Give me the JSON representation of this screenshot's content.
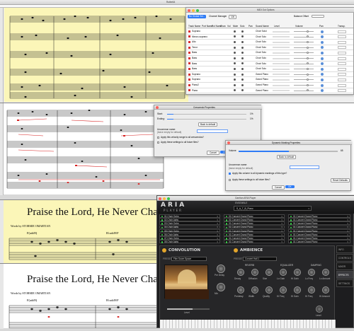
{
  "top_window": {
    "title": "Rutter64"
  },
  "mixer": {
    "title": "MIDI Out Options",
    "header_buttons": [
      "No Global Vol...",
      "Channel Manager",
      "Balance Offset"
    ],
    "header_value": "100",
    "columns": [
      "Track Name",
      "Port Name",
      "Rol Name",
      "Chan",
      "Vol",
      "Mute",
      "Solo",
      "Pan",
      "Sound Name",
      "Level",
      "Volume",
      "Pan",
      "Transp."
    ],
    "rows": [
      {
        "track": "Soprano",
        "sound": "Choir Soloi"
      },
      {
        "track": "Mezzo-soprano",
        "sound": "Choir Solo"
      },
      {
        "track": "Alto",
        "sound": "Choir Solo"
      },
      {
        "track": "Tenor",
        "sound": "Choir Solo"
      },
      {
        "track": "Bass",
        "sound": "Choir Solo"
      },
      {
        "track": "Bass",
        "sound": "Choir Solo"
      },
      {
        "track": "Bass",
        "sound": "Choir Solo"
      },
      {
        "track": "Bass",
        "sound": "Choir Solo"
      },
      {
        "track": "Soprano",
        "sound": "Grand Piano"
      },
      {
        "track": "Soprano",
        "sound": "Grand Piano"
      },
      {
        "track": "Piano2",
        "sound": "Grand Piano"
      },
      {
        "track": "Piano",
        "sound": "Grand Piano"
      }
    ]
  },
  "crescendo": {
    "title": "Crescendo Properties",
    "start_label": "Start:",
    "start_value": "1%",
    "ending_label": "Ending:",
    "ending_value": "1%",
    "back_default": "Back to default",
    "name_label": "Uncommon name:",
    "name_hint": "(leave empty for default)",
    "check1": "Apply this velocity range to all crescendos?",
    "check2": "Apply these settings to all future files?",
    "cancel": "Cancel",
    "ok": "OK"
  },
  "dynamic": {
    "title": "Dynamic Marking Properties",
    "volume_label": "Volume",
    "volume_value": "65",
    "back_default": "Back to default",
    "name_label": "Uncommon name:",
    "name_hint": "(leave empty for default)",
    "check1": "Apply this volume to all dynamic markings of this type?",
    "check2": "Apply these settings to all future files?",
    "reset": "Reset Defaults",
    "cancel": "Cancel",
    "ok": "OK"
  },
  "score": {
    "title": "Praise the Lord, He Never Cha",
    "title2": "Praise the Lord, He Never Cha",
    "words_by": "Words by STORMIE OMARTIAN",
    "chord1": "F(add9)",
    "chord2": "B♭add9/F",
    "chord3": "F(add9)",
    "chord4": "B♭add9/F"
  },
  "aria": {
    "window_title": "Garritan ARIA Player",
    "logo_top": "ARIA",
    "logo_bottom": "PLAYER",
    "ensemble_label": "ENSEMBLE",
    "ensemble_value": "S_A_T_B_Piano",
    "slots_left": [
      "01 Choir Oohs",
      "02 Choir Aahs",
      "03 Choir Oohs",
      "04 Choir Aahs",
      "05 Choir Oohs",
      "06 Choir Aahs",
      "07 Choir Oohs",
      "08 Choir Aahs"
    ],
    "slots_mid": [
      "01 Concert Grand Piano",
      "01 Concert Grand Piano",
      "01 Concert Grand Piano",
      "01 Concert Grand Piano",
      "01 Concert Grand Piano",
      "01 Concert Grand Piano",
      "01 Concert Grand Piano",
      "01 Concert Grand Piano"
    ],
    "slots_right": [
      "01 Concert Grand Piano",
      "01 Concert Grand Piano",
      "01 Concert Grand Piano",
      "01 Concert Grand Piano",
      "01 Concert Grand Piano",
      "01 Concert Grand Piano",
      "01 Concert Grand Piano",
      "01 Concert Grand Piano"
    ],
    "empty_label": "empty",
    "convolution": "CONVOLUTION",
    "ambience": "AMBIENCE",
    "preset_label": "PRESET",
    "conv_preset": "Film Score Space",
    "amb_preset": "Concert Hall 1",
    "reverb": "REVERB",
    "equalizer": "EQUALIZER",
    "damping": "DAMPING",
    "conv_knobs": [
      "Pre Delay",
      "Mix"
    ],
    "conv_bottom": [
      "Level"
    ],
    "amb_knobs_top": [
      "Decay",
      "Diffusion",
      "Size",
      "Lo Gain",
      "Hi Gain",
      "Lo Freq",
      "Lo Amount"
    ],
    "amb_knobs_bottom": [
      "Predelay",
      "Width",
      "Quality",
      "Hi Freq",
      "Hi Gain",
      "Hi Freq",
      "Hi Amount"
    ],
    "tabs": [
      "INFO",
      "CONTROLS",
      "MIXER",
      "EFFECTS",
      "SETTINGS"
    ],
    "active_tab": "EFFECTS",
    "level_label": "Level"
  }
}
